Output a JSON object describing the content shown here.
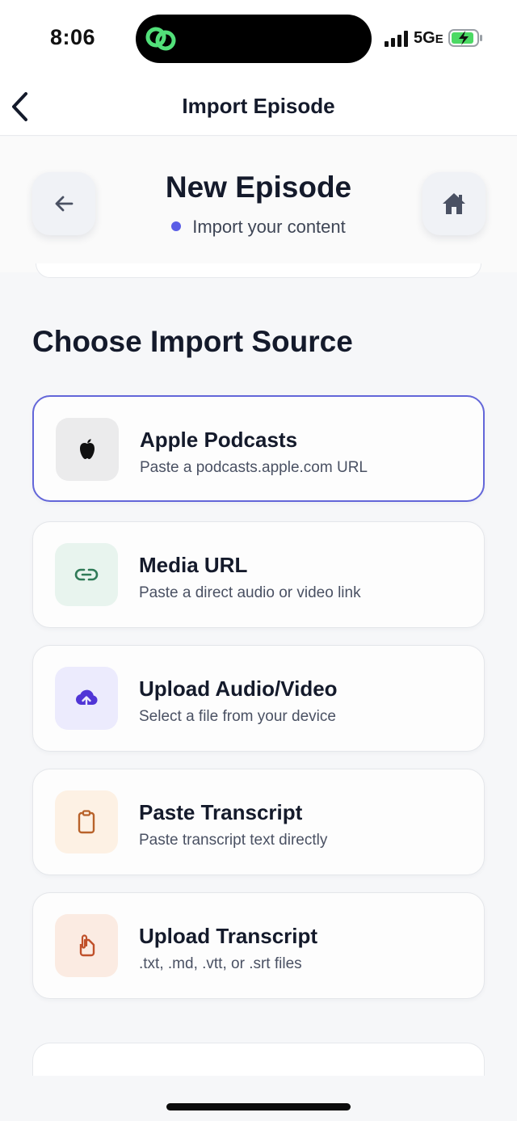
{
  "status_bar": {
    "time": "8:06",
    "network": "5G",
    "network_suffix": "E",
    "island_icon": "link-rings-icon",
    "signal_icon": "signal-bars-icon",
    "battery_icon": "battery-charging-icon"
  },
  "nav": {
    "title": "Import Episode",
    "back_icon": "chevron-left-icon"
  },
  "header": {
    "title": "New Episode",
    "subtitle": "Import your content",
    "left_button_icon": "arrow-left-icon",
    "right_button_icon": "home-icon",
    "dot_color": "#5b5ee6"
  },
  "section_title": "Choose Import Source",
  "sources": [
    {
      "title": "Apple Podcasts",
      "subtitle": "Paste a podcasts.apple.com URL",
      "icon": "apple-icon",
      "icon_bg": "#ebebec",
      "icon_color": "#111111",
      "selected": true
    },
    {
      "title": "Media URL",
      "subtitle": "Paste a direct audio or video link",
      "icon": "link-icon",
      "icon_bg": "#e8f4ee",
      "icon_color": "#2f7a57",
      "selected": false
    },
    {
      "title": "Upload Audio/Video",
      "subtitle": "Select a file from your device",
      "icon": "cloud-upload-icon",
      "icon_bg": "#ecebfd",
      "icon_color": "#5035d6",
      "selected": false
    },
    {
      "title": "Paste Transcript",
      "subtitle": "Paste transcript text directly",
      "icon": "clipboard-icon",
      "icon_bg": "#fdf1e4",
      "icon_color": "#b8622a",
      "selected": false
    },
    {
      "title": "Upload Transcript",
      "subtitle": ".txt, .md, .vtt, or .srt files",
      "icon": "file-attachment-icon",
      "icon_bg": "#fbebe2",
      "icon_color": "#c0502a",
      "selected": false
    }
  ],
  "colors": {
    "accent": "#6366d9",
    "text": "#141a2b",
    "subtext": "#4a5163"
  }
}
